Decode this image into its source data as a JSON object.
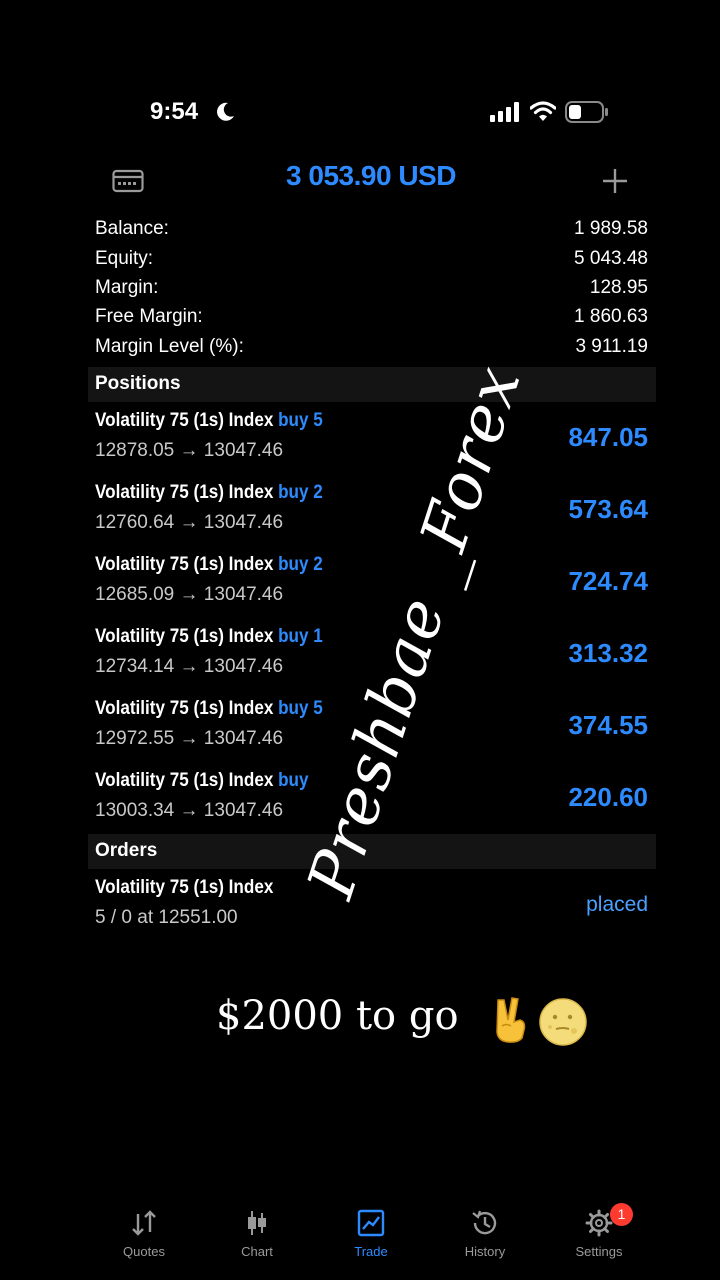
{
  "status_bar": {
    "time": "9:54"
  },
  "header": {
    "total": "3 053.90 USD"
  },
  "account": [
    {
      "label": "Balance:",
      "value": "1 989.58"
    },
    {
      "label": "Equity:",
      "value": "5 043.48"
    },
    {
      "label": "Margin:",
      "value": "128.95"
    },
    {
      "label": "Free Margin:",
      "value": "1 860.63"
    },
    {
      "label": "Margin Level (%):",
      "value": "3 911.19"
    }
  ],
  "positions_title": "Positions",
  "positions": [
    {
      "symbol": "Volatility 75 (1s) Index",
      "side": "buy 5",
      "prices": "12878.05 → 13047.46",
      "profit": "847.05"
    },
    {
      "symbol": "Volatility 75 (1s) Index",
      "side": "buy 2",
      "prices": "12760.64 → 13047.46",
      "profit": "573.64"
    },
    {
      "symbol": "Volatility 75 (1s) Index",
      "side": "buy 2",
      "prices": "12685.09 → 13047.46",
      "profit": "724.74"
    },
    {
      "symbol": "Volatility 75 (1s) Index",
      "side": "buy 1",
      "prices": "12734.14 → 13047.46",
      "profit": "313.32"
    },
    {
      "symbol": "Volatility 75 (1s) Index",
      "side": "buy 5",
      "prices": "12972.55 → 13047.46",
      "profit": "374.55"
    },
    {
      "symbol": "Volatility 75 (1s) Index",
      "side": "buy",
      "prices": "13003.34 → 13047.46",
      "profit": "220.60"
    }
  ],
  "orders_title": "Orders",
  "orders": [
    {
      "symbol": "Volatility 75 (1s) Index",
      "detail": "5 / 0 at 12551.00",
      "status": "placed"
    }
  ],
  "watermark": "Preshbae _Forex",
  "caption": "$2000 to go",
  "tabs": [
    {
      "label": "Quotes",
      "icon": "quotes-icon"
    },
    {
      "label": "Chart",
      "icon": "chart-icon"
    },
    {
      "label": "Trade",
      "icon": "trade-icon",
      "active": true
    },
    {
      "label": "History",
      "icon": "history-icon"
    },
    {
      "label": "Settings",
      "icon": "settings-icon"
    }
  ],
  "settings_badge": "1",
  "colors": {
    "accent": "#2e8bff",
    "background": "#000000",
    "badge": "#ff3b30"
  }
}
